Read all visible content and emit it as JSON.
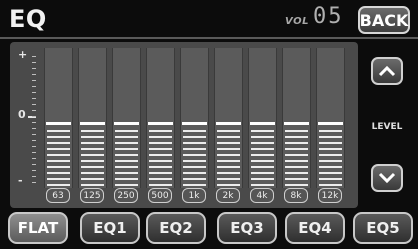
{
  "header": {
    "title": "EQ",
    "vol_label": "VOL",
    "vol_value": "05",
    "back_label": "BACK"
  },
  "scale": {
    "plus": "+",
    "zero": "0",
    "minus": "-"
  },
  "bands": [
    {
      "freq": "63",
      "level": 0
    },
    {
      "freq": "125",
      "level": 0
    },
    {
      "freq": "250",
      "level": 0
    },
    {
      "freq": "500",
      "level": 0
    },
    {
      "freq": "1k",
      "level": 0
    },
    {
      "freq": "2k",
      "level": 0
    },
    {
      "freq": "4k",
      "level": 0
    },
    {
      "freq": "8k",
      "level": 0
    },
    {
      "freq": "12k",
      "level": 0
    }
  ],
  "level": {
    "label": "LEVEL",
    "up_icon": "chevron-up-icon",
    "down_icon": "chevron-down-icon"
  },
  "presets": {
    "flat": "FLAT",
    "eq1": "EQ1",
    "eq2": "EQ2",
    "eq3": "EQ3",
    "eq4": "EQ4",
    "eq5": "EQ5",
    "selected": "FLAT"
  }
}
